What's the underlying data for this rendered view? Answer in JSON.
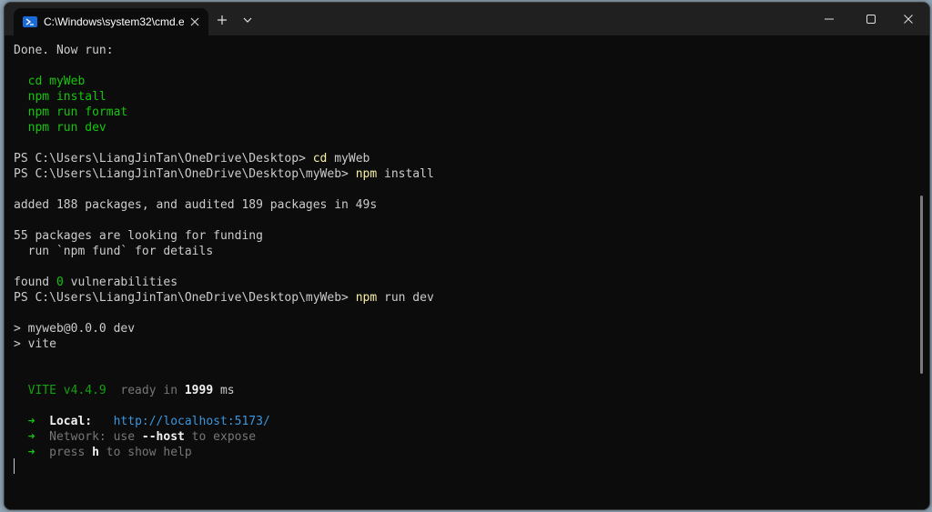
{
  "window": {
    "tab_title": "C:\\Windows\\system32\\cmd.e",
    "icons": {
      "tab": "powershell-icon",
      "close_tab": "close-icon",
      "new_tab": "plus-icon",
      "dropdown": "chevron-down-icon",
      "minimize": "minimize-icon",
      "maximize": "maximize-icon",
      "close": "close-icon"
    }
  },
  "terminal": {
    "l1": "Done. Now run:",
    "l2": "  cd myWeb",
    "l3": "  npm install",
    "l4": "  npm run format",
    "l5": "  npm run dev",
    "prompt1": "PS C:\\Users\\LiangJinTan\\OneDrive\\Desktop> ",
    "cmd1": "cd",
    "cmd1_args": " myWeb",
    "prompt2": "PS C:\\Users\\LiangJinTan\\OneDrive\\Desktop\\myWeb> ",
    "cmd2": "npm",
    "cmd2_args": " install",
    "l8": "added 188 packages, and audited 189 packages in 49s",
    "l9": "55 packages are looking for funding",
    "l10": "  run `npm fund` for details",
    "found_a": "found ",
    "found_zero": "0",
    "found_b": " vulnerabilities",
    "prompt3": "PS C:\\Users\\LiangJinTan\\OneDrive\\Desktop\\myWeb> ",
    "cmd3": "npm",
    "cmd3_args": " run dev",
    "l12": "> myweb@0.0.0 dev",
    "l13": "> vite",
    "vite_name": "  VITE v4.4.9",
    "vite_ready": "  ready in ",
    "vite_ms": "1999",
    "vite_unit": " ms",
    "arrow": "  ➜",
    "local_label": "  Local:",
    "local_url": "   http://localhost:5173/",
    "network_a": "  Network: use ",
    "network_b": "--host",
    "network_c": " to expose",
    "help_a": "  press ",
    "help_b": "h",
    "help_c": " to show help"
  },
  "colors": {
    "background": "#0c0c0c",
    "titlebar": "#202020",
    "text": "#cccccc",
    "green": "#16c60c",
    "yellow": "#f9f1a5",
    "url": "#3a96dd"
  }
}
